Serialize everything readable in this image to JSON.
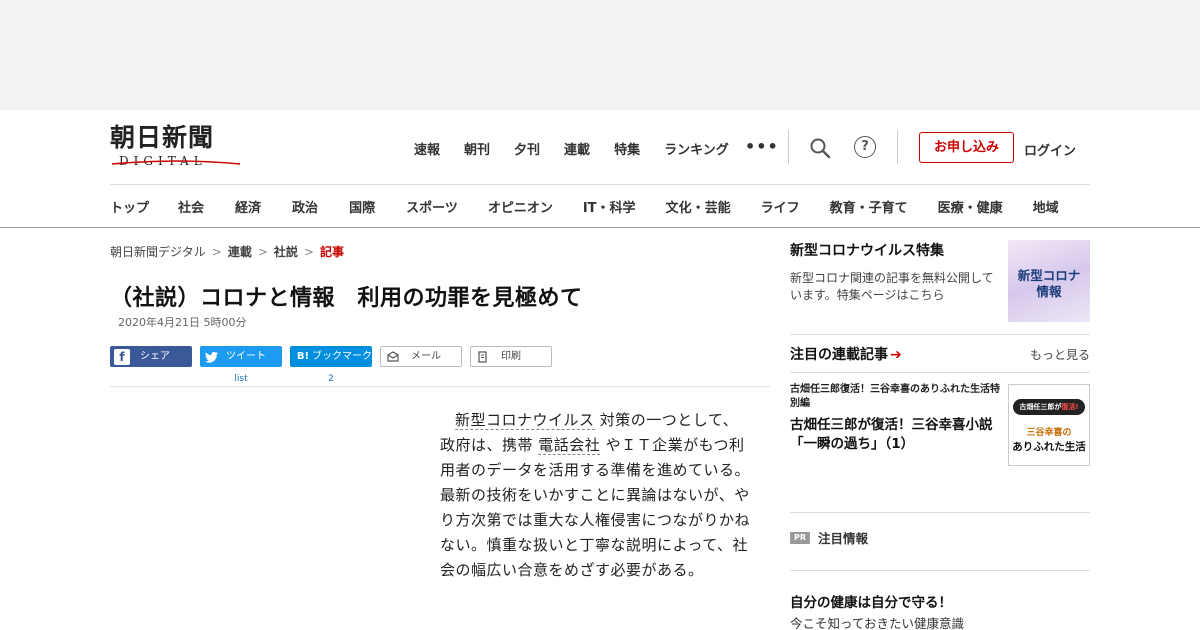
{
  "logo": {
    "main": "朝日新聞",
    "sub": "DIGITAL"
  },
  "top_nav": [
    "速報",
    "朝刊",
    "夕刊",
    "連載",
    "特集",
    "ランキング"
  ],
  "more_dots": "•••",
  "help_glyph": "?",
  "subscribe_label": "お申し込み",
  "login_label": "ログイン",
  "category_nav": [
    "トップ",
    "社会",
    "経済",
    "政治",
    "国際",
    "スポーツ",
    "オピニオン",
    "IT・科学",
    "文化・芸能",
    "ライフ",
    "教育・子育て",
    "医療・健康",
    "地域"
  ],
  "breadcrumb": {
    "home": "朝日新聞デジタル",
    "c1": "連載",
    "c2": "社説",
    "current": "記事",
    "sep": ">"
  },
  "article": {
    "title": "（社説）コロナと情報　利用の功罪を見極めて",
    "date": "2020年4月21日 5時00分",
    "body_parts": [
      "新型コロナウイルス",
      "対策の一つとして、政府は、携帯",
      "電話会社",
      "やＩＴ企業がもつ利用者のデータを活用する準備を進めている。最新の技術をいかすことに異論はないが、やり方次第では重大な人権侵害につながりかねない。慎重な扱いと丁寧な説明によって、社会の幅広い合意をめざす必要がある。"
    ]
  },
  "share": {
    "facebook": "シェア",
    "twitter": "ツイート",
    "twitter_count": "list",
    "hatena": "ブックマーク",
    "hatena_icon": "B!",
    "hatena_count": "2",
    "mail": "メール",
    "print": "印刷",
    "facebook_icon": "f"
  },
  "sidebar": {
    "feature_title": "新型コロナウイルス特集",
    "feature_desc": "新型コロナ関連の記事を無料公開しています。特集ページはこちら",
    "feature_thumb_line1": "新型コロナ",
    "feature_thumb_line2": "情報",
    "serial_heading": "注目の連載記事",
    "serial_arrow": "➔",
    "more_label": "もっと見る",
    "serial_small": "古畑任三郎復活！三谷幸喜のありふれた生活特別編",
    "serial_title": "古畑任三郎が復活！三谷幸喜小説「一瞬の過ち」（1）",
    "serial_thumb_band_a": "古畑任三郎が",
    "serial_thumb_band_b": "復活!",
    "serial_thumb_line1": "三谷幸喜の",
    "serial_thumb_line2": "ありふれた生活",
    "pr_badge": "PR",
    "pr_label": "注目情報",
    "health_title": "自分の健康は自分で守る！",
    "health_sub": "今こそ知っておきたい健康意識"
  }
}
